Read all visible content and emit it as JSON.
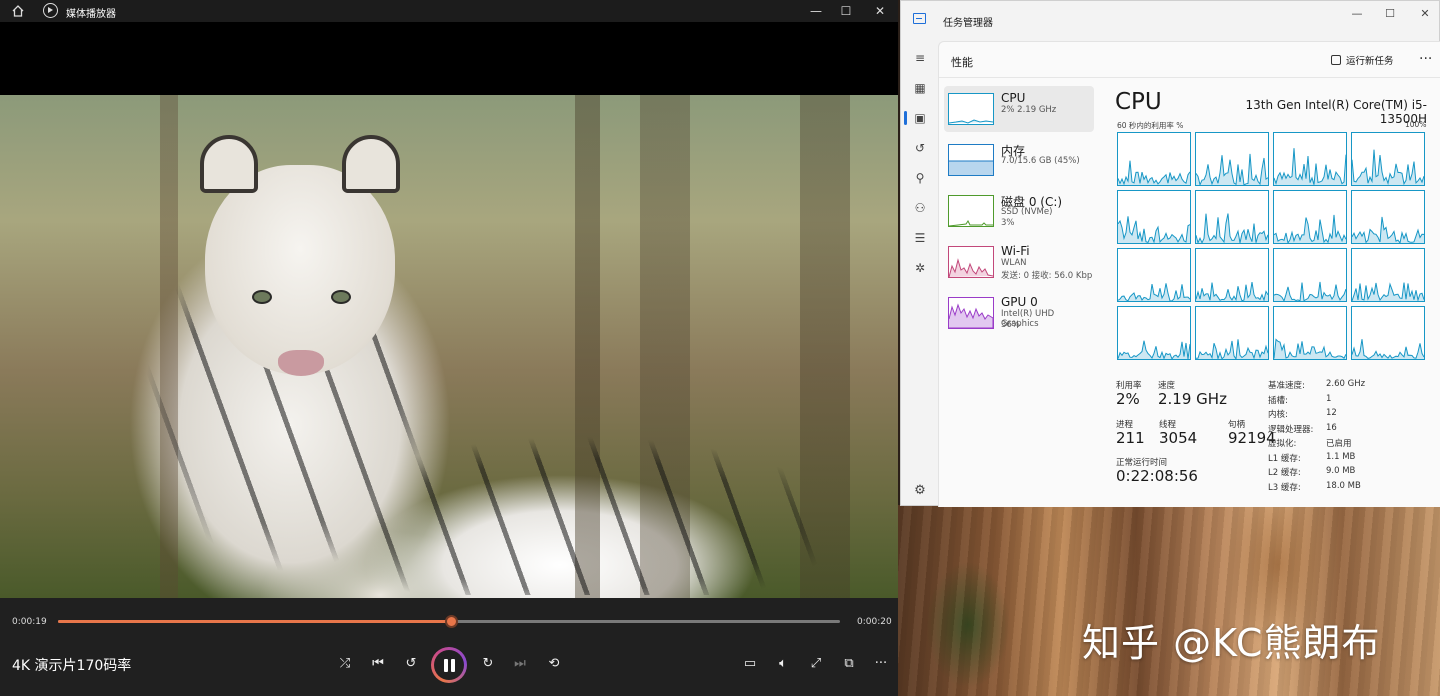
{
  "player": {
    "app_name": "媒体播放器",
    "current_time": "0:00:19",
    "remaining_time": "0:00:20",
    "progress_fraction": 0.503,
    "video_title": "4K 演示片170码率",
    "accent_color": "#e8764a"
  },
  "taskmanager": {
    "app_name": "任务管理器",
    "page_title": "性能",
    "run_new_task": "运行新任务",
    "more": "···",
    "nav_icons": [
      "menu-icon",
      "processes-icon",
      "performance-icon",
      "app-history-icon",
      "startup-icon",
      "users-icon",
      "details-icon",
      "services-icon"
    ],
    "items": [
      {
        "name": "CPU",
        "sub1": "2% 2.19 GHz",
        "sub2": ""
      },
      {
        "name": "内存",
        "sub1": "7.0/15.6 GB (45%)",
        "sub2": ""
      },
      {
        "name": "磁盘 0 (C:)",
        "sub1": "SSD (NVMe)",
        "sub2": "3%"
      },
      {
        "name": "Wi-Fi",
        "sub1": "WLAN",
        "sub2": "发送: 0 接收: 56.0 Kbp"
      },
      {
        "name": "GPU 0",
        "sub1": "Intel(R) UHD Graphics",
        "sub2": "36%"
      }
    ],
    "cpu": {
      "heading": "CPU",
      "model": "13th Gen Intel(R) Core(TM) i5-13500H",
      "graph_label": "60 秒内的利用率 %",
      "graph_max": "100%",
      "graph_color": "#1797c6",
      "stats": {
        "util_label": "利用率",
        "util": "2%",
        "speed_label": "速度",
        "speed": "2.19 GHz",
        "proc_label": "进程",
        "proc": "211",
        "thread_label": "线程",
        "thread": "3054",
        "handle_label": "句柄",
        "handle": "92194",
        "uptime_label": "正常运行时间",
        "uptime": "0:22:08:56"
      },
      "details": [
        {
          "k": "基准速度:",
          "v": "2.60 GHz"
        },
        {
          "k": "插槽:",
          "v": "1"
        },
        {
          "k": "内核:",
          "v": "12"
        },
        {
          "k": "逻辑处理器:",
          "v": "16"
        },
        {
          "k": "虚拟化:",
          "v": "已启用"
        },
        {
          "k": "L1 缓存:",
          "v": "1.1 MB"
        },
        {
          "k": "L2 缓存:",
          "v": "9.0 MB"
        },
        {
          "k": "L3 缓存:",
          "v": "18.0 MB"
        }
      ]
    }
  },
  "watermark": "知乎 @KC熊朗布"
}
